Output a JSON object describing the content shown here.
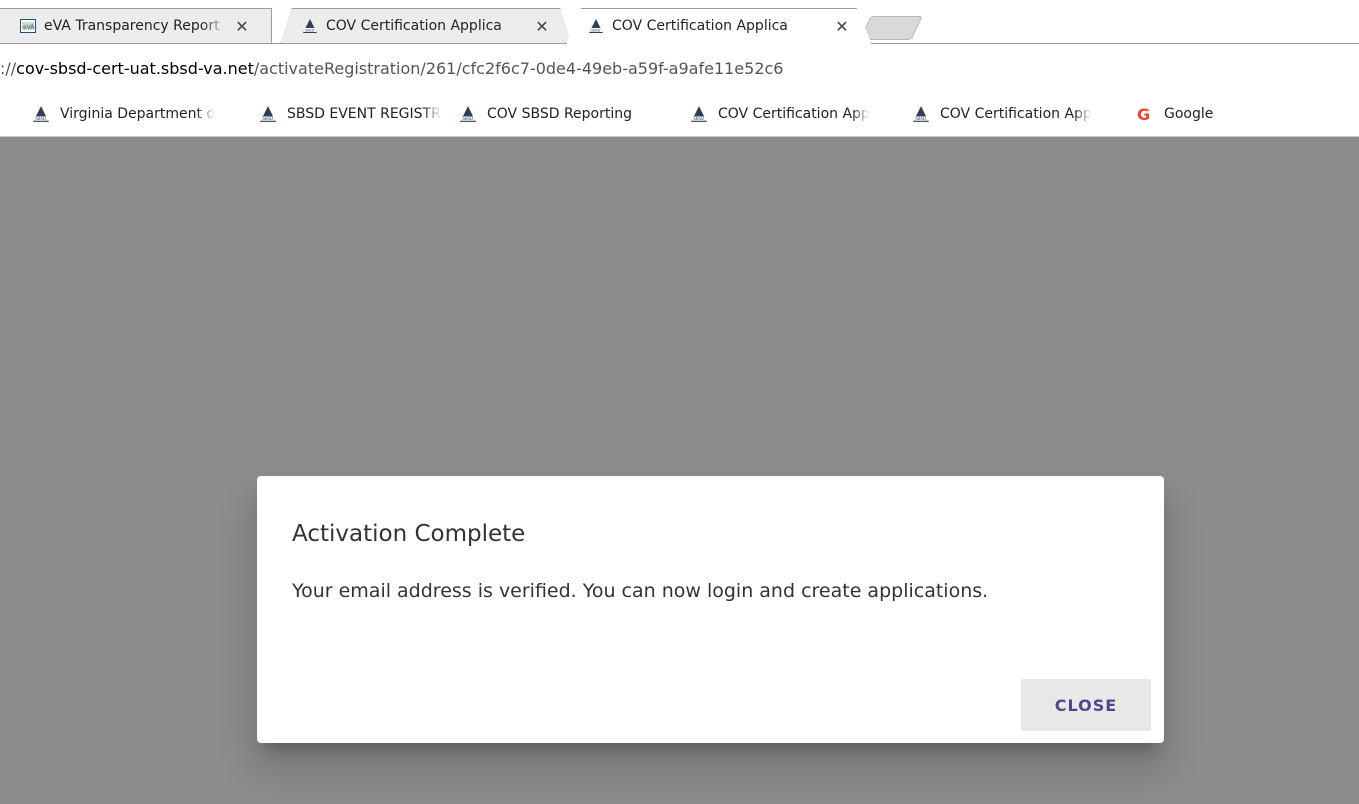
{
  "browser": {
    "tabs": [
      {
        "title": "eVA Transparency Report",
        "close": "✕",
        "icon": "eva-favicon",
        "active": false
      },
      {
        "title": "COV Certification Applica",
        "close": "✕",
        "icon": "sbsd-favicon",
        "active": false
      },
      {
        "title": "COV Certification Applica",
        "close": "✕",
        "icon": "sbsd-favicon",
        "active": true
      }
    ],
    "url": {
      "scheme": "://",
      "host": "cov-sbsd-cert-uat.sbsd-va.net",
      "path": "/activateRegistration/261/cfc2f6c7-0de4-49eb-a59f-a9afe11e52c6"
    },
    "bookmarks": [
      {
        "label": "Virginia Department o",
        "icon": "sbsd-favicon"
      },
      {
        "label": "SBSD EVENT REGISTR",
        "icon": "sbsd-favicon"
      },
      {
        "label": "COV SBSD Reporting",
        "icon": "sbsd-favicon"
      },
      {
        "label": "COV Certification App",
        "icon": "sbsd-favicon"
      },
      {
        "label": "COV Certification App",
        "icon": "sbsd-favicon"
      },
      {
        "label": "Google",
        "icon": "google-favicon"
      }
    ]
  },
  "colors": {
    "overlay": "#8c8c8c",
    "button_text": "#4a4a8a",
    "sbsd_icon": "#2e3f5c",
    "google_g": "#ea4335"
  },
  "dialog": {
    "title": "Activation Complete",
    "message": "Your email address is verified. You can now login and create applications.",
    "close_label": "CLOSE"
  }
}
